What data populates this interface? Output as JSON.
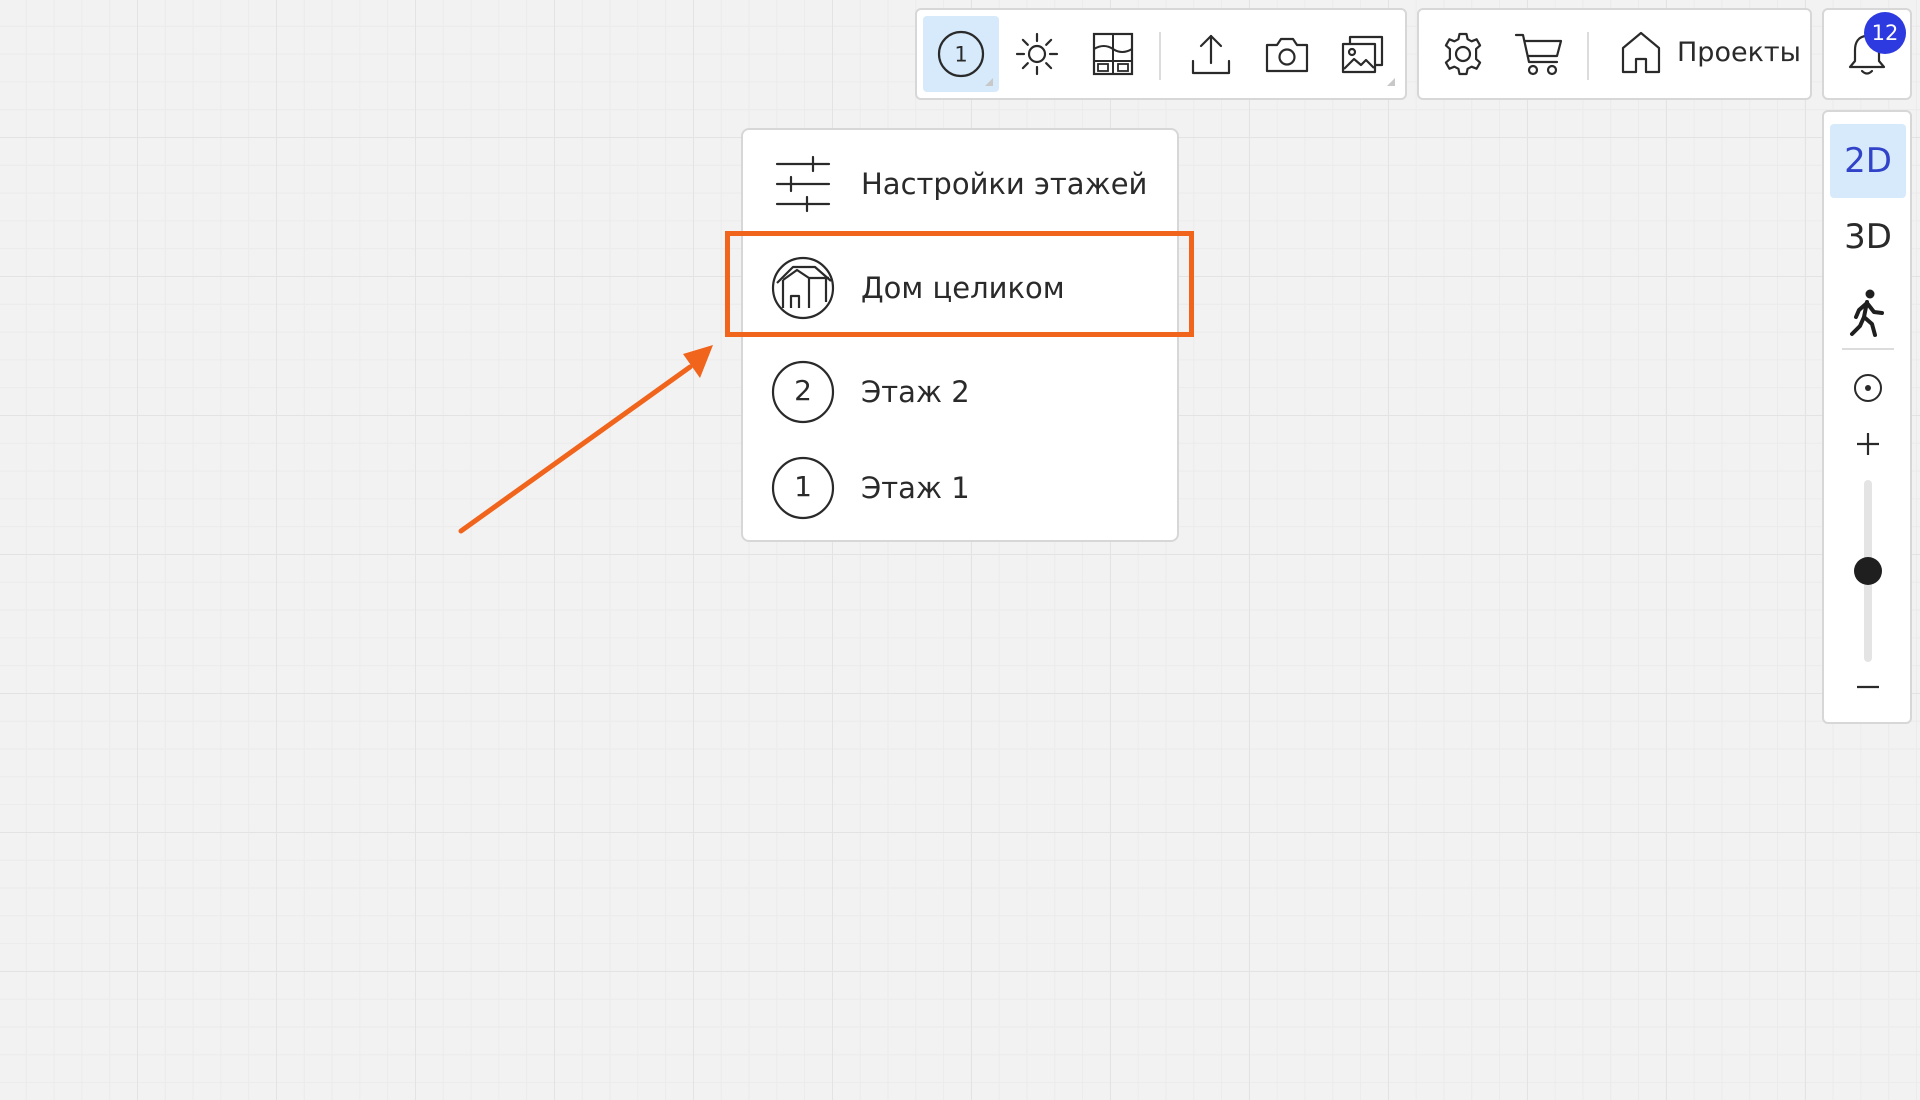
{
  "toolbar": {
    "floor_selector_number": "1",
    "projects_label": "Проекты"
  },
  "notifications": {
    "count": "12"
  },
  "view_panel": {
    "mode_2d": "2D",
    "mode_3d": "3D",
    "zoom_level": 0.5
  },
  "floor_menu": {
    "items": [
      {
        "label": "Настройки этажей",
        "icon": "sliders-icon"
      },
      {
        "label": "Дом целиком",
        "icon": "whole-house-icon"
      },
      {
        "label": "Этаж 2",
        "icon": "floor-number-icon",
        "number": "2"
      },
      {
        "label": "Этаж 1",
        "icon": "floor-number-icon",
        "number": "1"
      }
    ]
  },
  "annotation": {
    "color": "#f0641c"
  },
  "colors": {
    "accent_active_bg": "#d6eafb",
    "badge_bg": "#2d3ae0",
    "active_text": "#3143c8"
  }
}
